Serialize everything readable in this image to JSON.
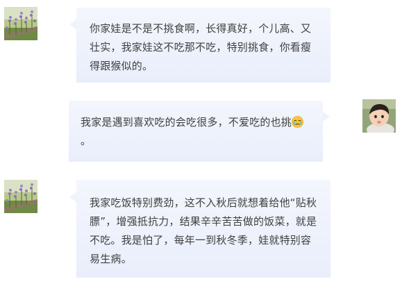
{
  "messages": [
    {
      "side": "left",
      "text": "你家娃是不是不挑食啊，长得真好，个儿高、又壮实，我家娃这不吃那不吃，特别挑食，你看瘦得跟猴似的。"
    },
    {
      "side": "right",
      "text": "我家是遇到喜欢吃的会吃很多，不爱吃的也挑",
      "emoji_icon": "crying-face-icon",
      "text_after": "。"
    },
    {
      "side": "left",
      "text": "我家吃饭特别费劲，这不入秋后就想着给他“贴秋膘”，增强抵抗力，结果辛辛苦苦做的饭菜，就是不吃。我是怕了，每年一到秋冬季，娃就特别容易生病。"
    }
  ],
  "colors": {
    "bubble_top": "#f4f6fd",
    "bubble_bottom": "#e9eefb",
    "text": "#3f3f3f"
  }
}
